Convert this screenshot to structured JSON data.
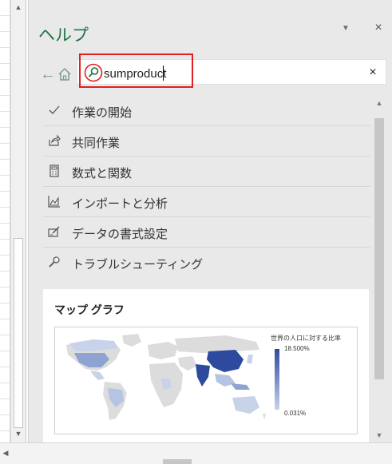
{
  "pane": {
    "title": "ヘルプ",
    "dropdown_icon": "chevron-down-icon",
    "close_label": "×"
  },
  "nav": {
    "back_label": "←",
    "home_icon": "home-icon"
  },
  "search": {
    "value": "sumproduct",
    "clear_label": "×"
  },
  "topics": [
    {
      "label": "作業の開始",
      "icon": "checkmark-icon"
    },
    {
      "label": "共同作業",
      "icon": "share-icon"
    },
    {
      "label": "数式と関数",
      "icon": "calculator-icon"
    },
    {
      "label": "インポートと分析",
      "icon": "chart-icon"
    },
    {
      "label": "データの書式設定",
      "icon": "format-icon"
    },
    {
      "label": "トラブルシューティング",
      "icon": "wrench-icon"
    }
  ],
  "card": {
    "title": "マップ グラフ",
    "legend_title": "世界の人口に対する比率",
    "legend_max": "18.500%",
    "legend_min": "0.031%"
  },
  "colors": {
    "accent": "#217346",
    "highlight": "#e02020",
    "map_dark": "#2e4a9e",
    "map_light": "#c8d3ea",
    "map_base": "#dcdcdc"
  }
}
